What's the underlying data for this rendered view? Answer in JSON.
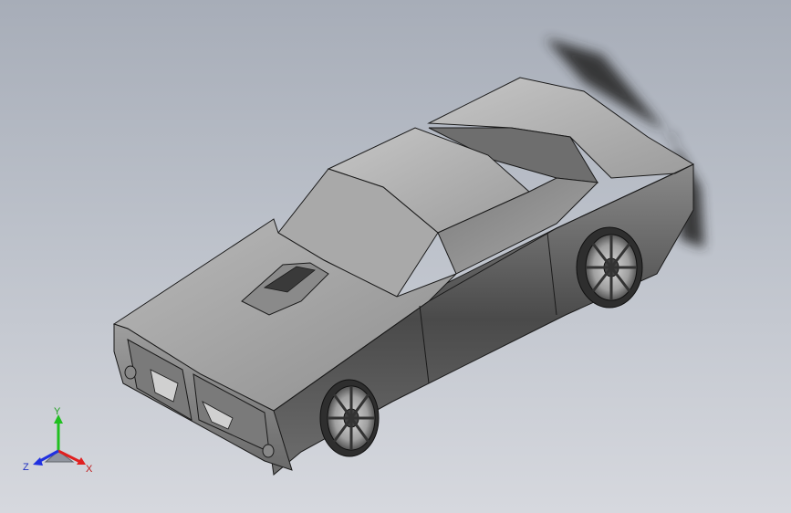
{
  "viewport": {
    "background_top": "#a7adb8",
    "background_bottom": "#d6d8de"
  },
  "model": {
    "name": "",
    "body_color": "#9a9a9a",
    "edge_color": "#1a1a1a"
  },
  "triad": {
    "x_label": "X",
    "y_label": "Y",
    "z_label": "Z",
    "x_color": "#e02020",
    "y_color": "#20c020",
    "z_color": "#2030e0"
  }
}
